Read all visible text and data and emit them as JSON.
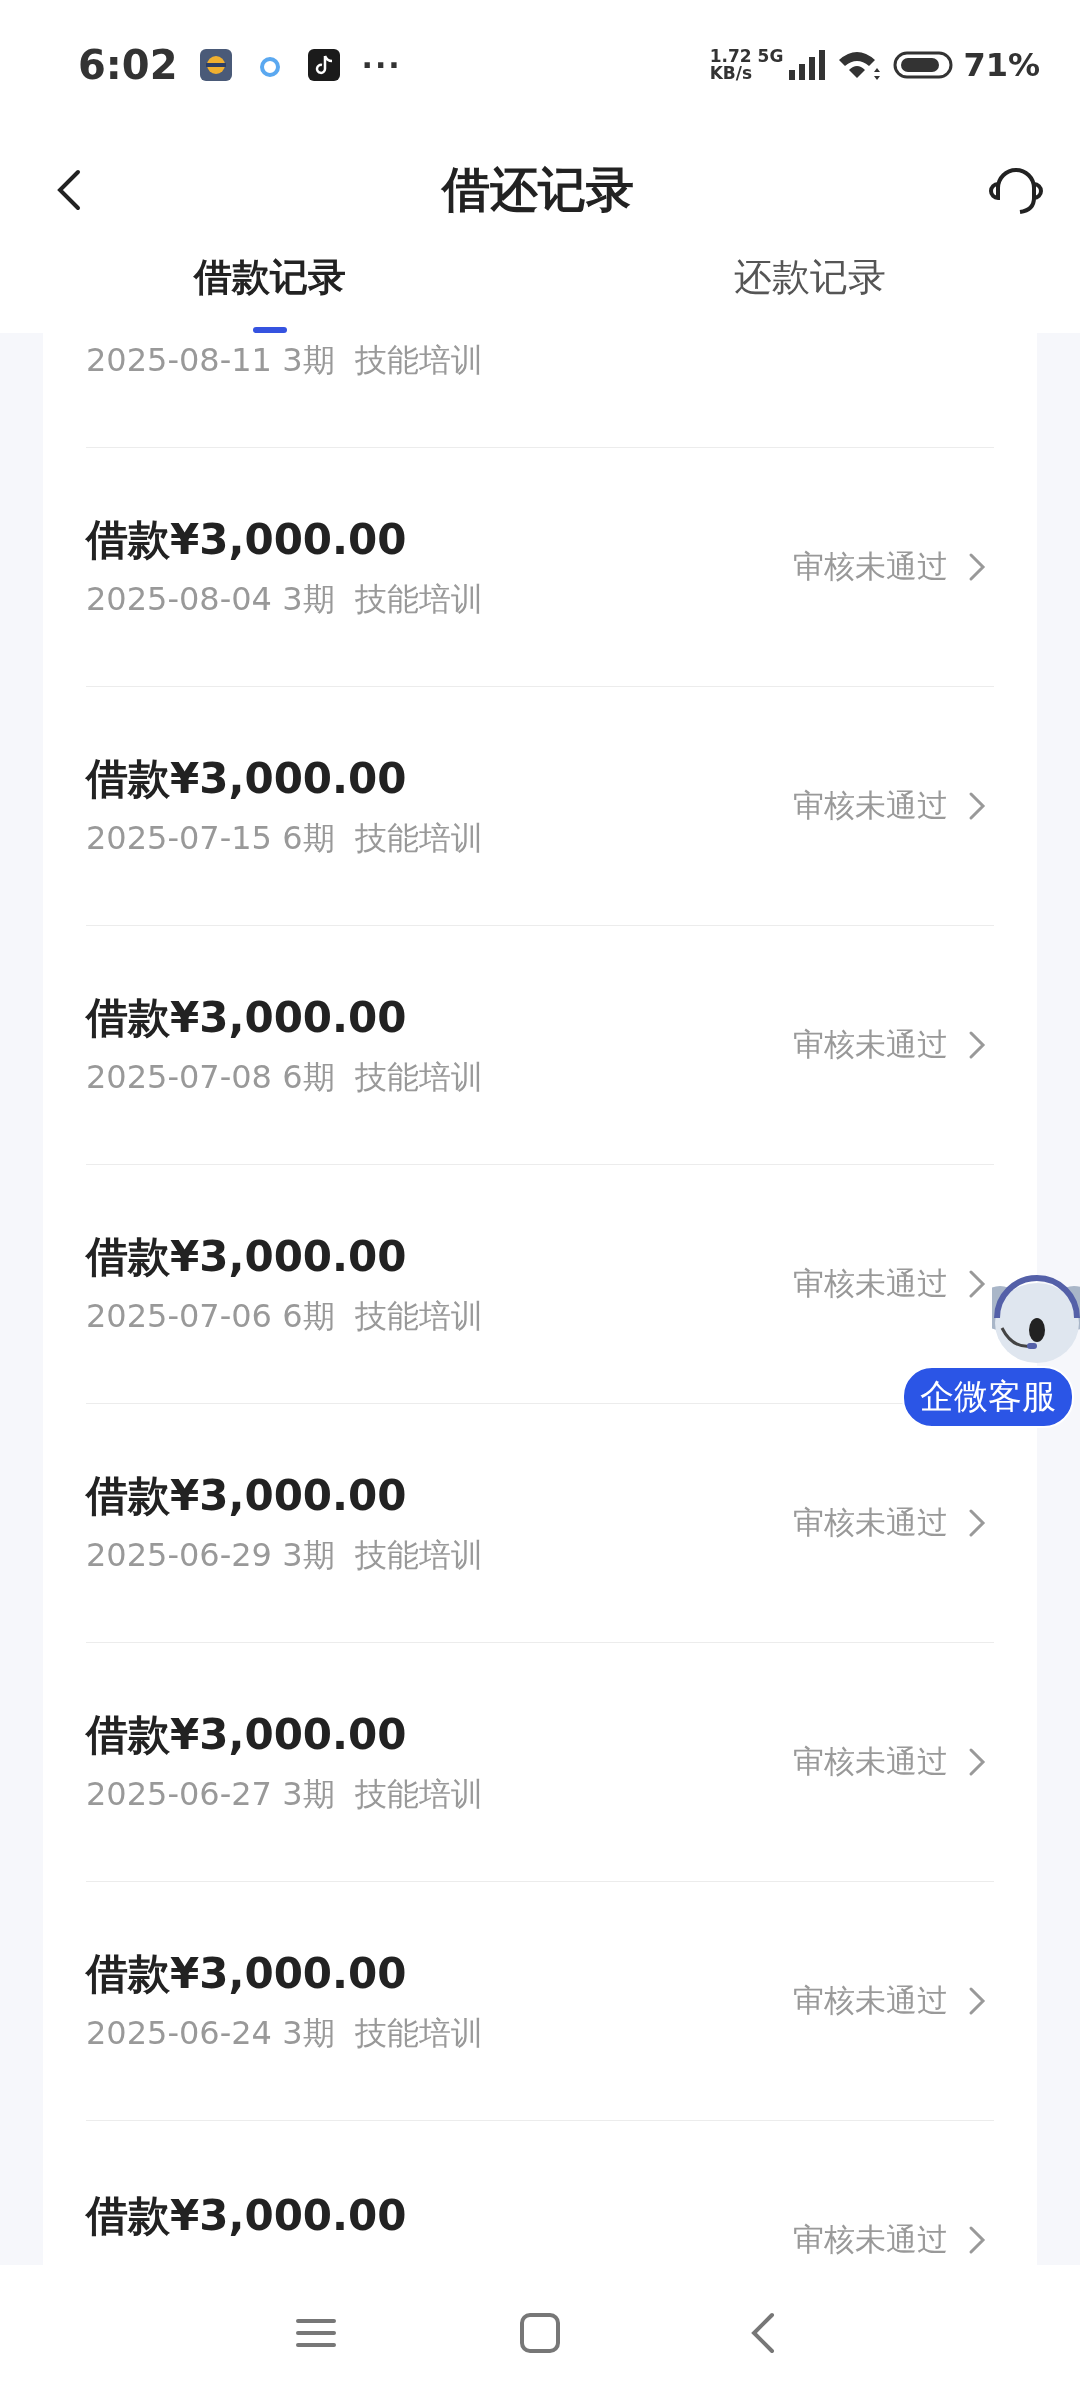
{
  "status_bar": {
    "time": "6:02",
    "more": "···",
    "speed": "1.72",
    "speed_unit": "KB/s",
    "network": "5G",
    "battery": "71%"
  },
  "header": {
    "title": "借还记录"
  },
  "tabs": [
    {
      "label": "借款记录",
      "selected": true
    },
    {
      "label": "还款记录",
      "selected": false
    }
  ],
  "records": [
    {
      "date": "2025-08-11",
      "term": "3期",
      "purpose": "技能培训"
    },
    {
      "amount": "借款¥3,000.00",
      "date": "2025-08-04",
      "term": "3期",
      "purpose": "技能培训",
      "status": "审核未通过"
    },
    {
      "amount": "借款¥3,000.00",
      "date": "2025-07-15",
      "term": "6期",
      "purpose": "技能培训",
      "status": "审核未通过"
    },
    {
      "amount": "借款¥3,000.00",
      "date": "2025-07-08",
      "term": "6期",
      "purpose": "技能培训",
      "status": "审核未通过"
    },
    {
      "amount": "借款¥3,000.00",
      "date": "2025-07-06",
      "term": "6期",
      "purpose": "技能培训",
      "status": "审核未通过"
    },
    {
      "amount": "借款¥3,000.00",
      "date": "2025-06-29",
      "term": "3期",
      "purpose": "技能培训",
      "status": "审核未通过"
    },
    {
      "amount": "借款¥3,000.00",
      "date": "2025-06-27",
      "term": "3期",
      "purpose": "技能培训",
      "status": "审核未通过"
    },
    {
      "amount": "借款¥3,000.00",
      "date": "2025-06-24",
      "term": "3期",
      "purpose": "技能培训",
      "status": "审核未通过"
    },
    {
      "amount": "借款¥3,000.00",
      "status": "审核未通过"
    }
  ],
  "service_badge": {
    "label": "企微客服"
  }
}
